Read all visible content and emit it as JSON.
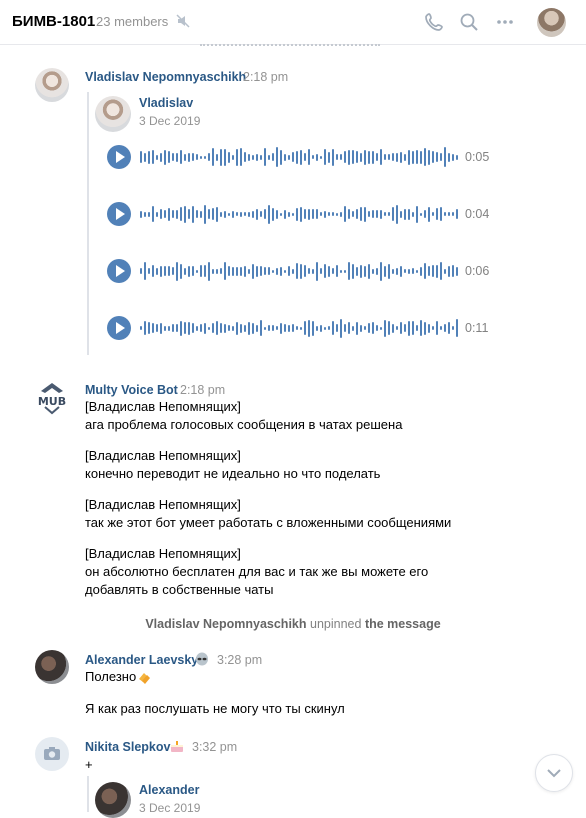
{
  "header": {
    "title": "БИМВ-1801",
    "members": "23 members",
    "icons": [
      "mute-icon",
      "phone-icon",
      "search-icon",
      "more-icon",
      "avatar"
    ]
  },
  "messages": [
    {
      "author": "Vladislav Nepomnyaschikh",
      "time": "2:18 pm",
      "forwarded": {
        "name": "Vladislav",
        "date": "3 Dec 2019",
        "voice": [
          {
            "duration": "0:05"
          },
          {
            "duration": "0:04"
          },
          {
            "duration": "0:06"
          },
          {
            "duration": "0:11"
          }
        ]
      }
    },
    {
      "author": "Multy Voice Bot",
      "time": "2:18 pm",
      "lines": [
        "[Владислав Непомнящих]",
        "ага проблема голосовых сообщения в чатах решена",
        "[Владислав Непомнящих]",
        "конечно переводит не идеально но что поделать",
        "[Владислав Непомнящих]",
        "так же этот бот умеет работать с вложенными сообщениями",
        "[Владислав Непомнящих]",
        "он абсолютно бесплатен для вас и так же вы можете его",
        "добавлять в собственные чаты"
      ]
    },
    {
      "system": {
        "actor": "Vladislav Nepomnyaschikh",
        "action": "unpinned",
        "object": "the message"
      }
    },
    {
      "author": "Alexander Laevsky",
      "time": "3:28 pm",
      "lines": [
        "Полезно",
        "Я как раз послушать не могу что ты скинул"
      ]
    },
    {
      "author": "Nikita Slepkov",
      "time": "3:32 pm",
      "lines": [
        "+"
      ],
      "forwarded": {
        "name": "Alexander",
        "date": "3 Dec 2019"
      }
    }
  ],
  "colors": {
    "accent": "#5181b8",
    "link": "#2a5885",
    "muted": "#939393"
  }
}
